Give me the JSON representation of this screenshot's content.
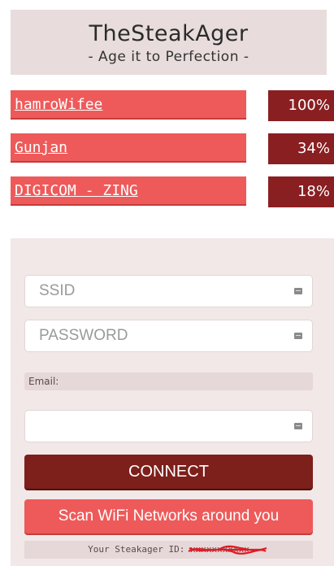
{
  "header": {
    "title": "TheSteakAger",
    "subtitle": "- Age it to Perfection -"
  },
  "networks": [
    {
      "ssid": "hamroWifee",
      "signal": "100%"
    },
    {
      "ssid": "Gunjan",
      "signal": "34%"
    },
    {
      "ssid": "DIGICOM - ZING",
      "signal": "18%"
    }
  ],
  "form": {
    "ssid_placeholder": "SSID",
    "password_placeholder": "PASSWORD",
    "email_label": "Email:",
    "email_value": "",
    "connect_label": "CONNECT",
    "scan_label": "Scan WiFi Networks around you",
    "id_label": "Your Steakager ID:",
    "id_value": "xxxxxxxxxxx",
    "id_redacted": true
  },
  "colors": {
    "network_bg": "#ee5a5a",
    "signal_bg": "#8a1f22",
    "connect_bg": "#7d1f1a",
    "panel_bg": "#f2e8e8"
  }
}
